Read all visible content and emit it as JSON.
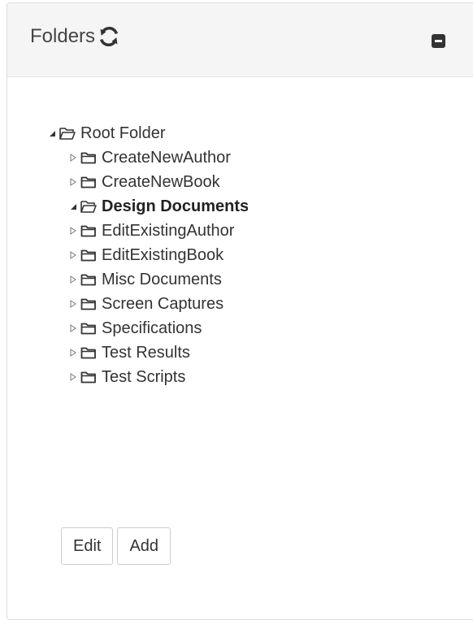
{
  "panel": {
    "title": "Folders",
    "refresh_icon": "refresh-icon",
    "collapse_icon": "minus-square-icon"
  },
  "tree": {
    "root": {
      "label": "Root Folder",
      "expanded": true,
      "icon": "folder-open-icon"
    },
    "children": [
      {
        "label": "CreateNewAuthor",
        "expanded": false,
        "selected": false
      },
      {
        "label": "CreateNewBook",
        "expanded": false,
        "selected": false
      },
      {
        "label": "Design Documents",
        "expanded": true,
        "selected": true
      },
      {
        "label": "EditExistingAuthor",
        "expanded": false,
        "selected": false
      },
      {
        "label": "EditExistingBook",
        "expanded": false,
        "selected": false
      },
      {
        "label": "Misc Documents",
        "expanded": false,
        "selected": false
      },
      {
        "label": "Screen Captures",
        "expanded": false,
        "selected": false
      },
      {
        "label": "Specifications",
        "expanded": false,
        "selected": false
      },
      {
        "label": "Test Results",
        "expanded": false,
        "selected": false
      },
      {
        "label": "Test Scripts",
        "expanded": false,
        "selected": false
      }
    ]
  },
  "buttons": {
    "edit": "Edit",
    "add": "Add"
  }
}
